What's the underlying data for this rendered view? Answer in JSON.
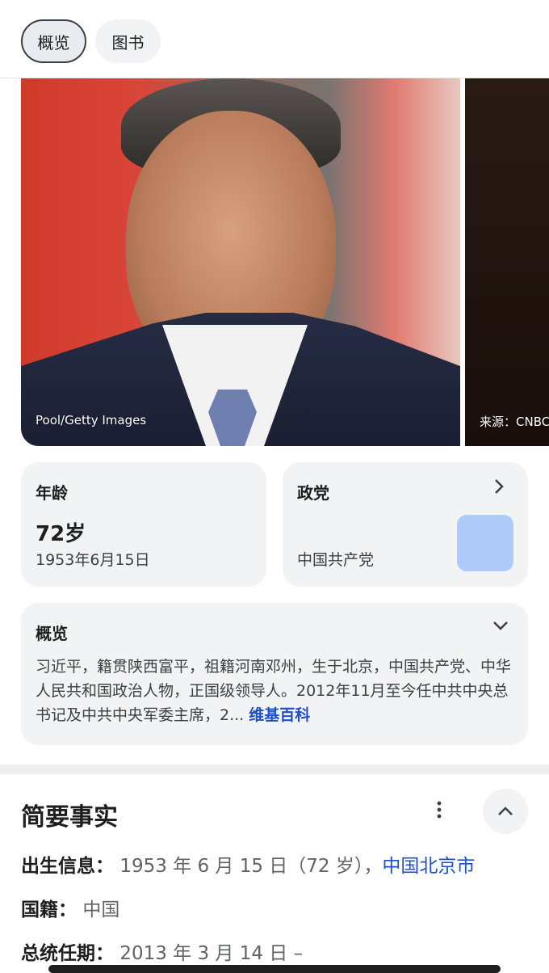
{
  "tabs": [
    {
      "label": "概览",
      "active": true
    },
    {
      "label": "图书",
      "active": false
    }
  ],
  "images": {
    "credit_1": "Pool/Getty Images",
    "credit_2": "来源：CNBC"
  },
  "age_card": {
    "title": "年龄",
    "value": "72岁",
    "birth_date": "1953年6月15日"
  },
  "party_card": {
    "title": "政党",
    "value": "中国共产党",
    "logo_color": "#aecbfa"
  },
  "overview_card": {
    "title": "概览",
    "text": "习近平，籍贯陕西富平，祖籍河南邓州，生于北京，中国共产党、中华人民共和国政治人物，正国级领导人。2012年11月至今任中共中央总书记及中共中央军委主席，2...",
    "source_link": "维基百科"
  },
  "quick_facts": {
    "title": "简要事实",
    "items": [
      {
        "label": "出生信息：",
        "value": "1953 年 6 月 15 日（72 岁），",
        "link": "中国北京市"
      },
      {
        "label": "国籍：",
        "value": "中国"
      },
      {
        "label": "总统任期：",
        "value": "2013 年 3 月 14 日 –"
      }
    ]
  },
  "colors": {
    "link": "#1f4ec8",
    "card_bg": "#f1f3f4"
  }
}
